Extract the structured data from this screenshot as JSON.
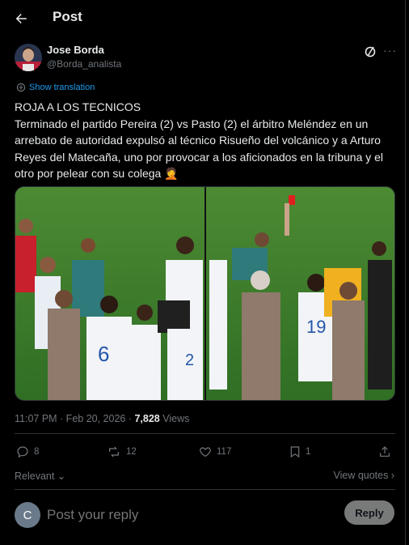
{
  "header": {
    "title": "Post"
  },
  "author": {
    "name": "Jose Borda",
    "handle": "@Borda_analista"
  },
  "translate_label": "Show translation",
  "post": {
    "line1": "ROJA A LOS TECNICOS",
    "line2": "Terminado el partido Pereira (2) vs Pasto (2) el árbitro Meléndez en un arrebato de autoridad expulsó al técnico Risueño del volcánico y a Arturo Reyes del Mateсaña, uno por provocar a los aficionados en la tribuna y el otro por pelear con su colega",
    "emoji": "🤦"
  },
  "meta": {
    "time": "11:07 PM · Feb 20, 2026 · ",
    "views_count": "7,828",
    "views_label": " Views"
  },
  "actions": {
    "replies": "8",
    "reposts": "12",
    "likes": "117",
    "bookmarks": "1"
  },
  "sort": {
    "relevant": "Relevant ⌄",
    "view_quotes": "View quotes ›"
  },
  "reply": {
    "avatar_letter": "C",
    "placeholder": "Post your reply",
    "button": "Reply"
  },
  "colors": {
    "accent": "#1d9bf0",
    "bg": "#000000",
    "muted": "#71767b",
    "text": "#e7e9ea"
  }
}
